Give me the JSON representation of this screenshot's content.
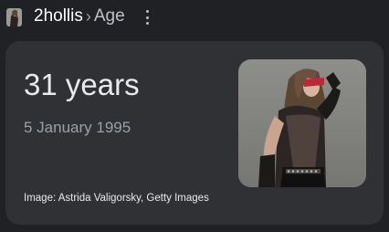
{
  "header": {
    "subject": "2hollis",
    "separator": "›",
    "attribute": "Age"
  },
  "card": {
    "age": "31 years",
    "birth_date": "5 January 1995",
    "image_credit": "Image: Astrida Valigorsky, Getty Images"
  },
  "icons": {
    "more": "more-vert-icon"
  },
  "colors": {
    "page_bg": "#202124",
    "card_bg": "#303134",
    "primary_text": "#e8eaed",
    "secondary_text": "#9aa0a6"
  }
}
